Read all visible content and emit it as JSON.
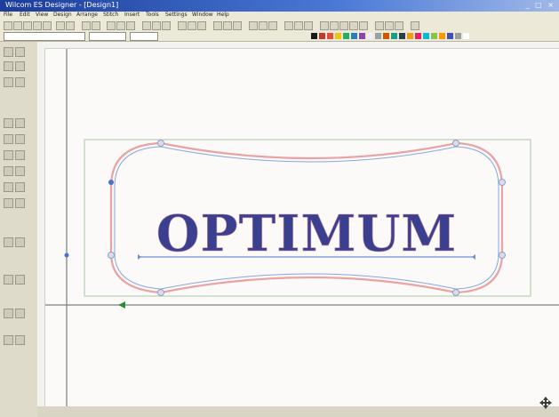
{
  "window": {
    "title": "Wilcom ES Designer - [Design1]",
    "controls": "_ □ ×"
  },
  "menu": {
    "items": [
      "File",
      "Edit",
      "View",
      "Design",
      "Arrange",
      "Stitch",
      "Insert",
      "Tools",
      "Settings",
      "Window",
      "Help"
    ]
  },
  "design": {
    "text": "OPTIMUM",
    "text_color": "#3a3f8f",
    "outline_color": "#e8a3a3",
    "guide_color": "#6c8fd6",
    "bounding_box_color": "#a9c7a9"
  },
  "colors": {
    "palette": [
      "#1a1a1a",
      "#c0392b",
      "#e74c3c",
      "#f1c40f",
      "#27ae60",
      "#2980b9",
      "#8e44ad",
      "#ecf0f1",
      "#95a5a6",
      "#d35400",
      "#16a085",
      "#2c3e50",
      "#f39c12",
      "#e91e63",
      "#00bcd4",
      "#8bc34a",
      "#ff9800",
      "#3f51b5",
      "#9e9e9e",
      "#ffffff"
    ]
  },
  "icons": [
    "select-icon",
    "new-file-icon",
    "open-icon",
    "save-icon",
    "print-icon",
    "undo-icon",
    "redo-icon",
    "zoom-icon",
    "lettering-icon",
    "digitize-icon",
    "fill-icon",
    "outline-icon"
  ]
}
